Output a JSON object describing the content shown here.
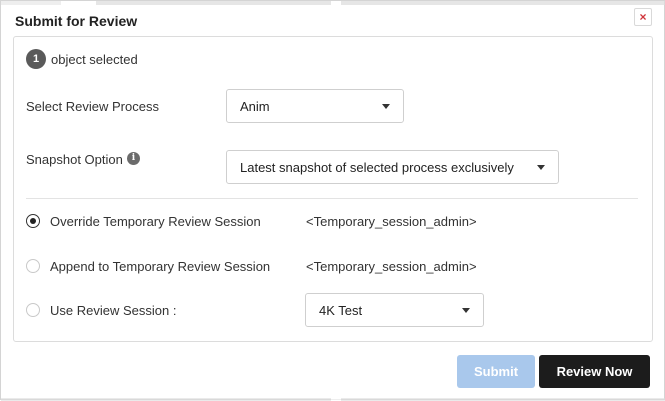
{
  "dialog": {
    "title": "Submit for Review",
    "close_label": "×"
  },
  "selection": {
    "count": "1",
    "text": "object selected"
  },
  "review_process": {
    "label": "Select Review Process",
    "value": "Anim"
  },
  "snapshot": {
    "label": "Snapshot Option",
    "info_glyph": "i",
    "value": "Latest snapshot of selected process exclusively"
  },
  "session_options": [
    {
      "label": "Override Temporary Review Session",
      "value": "<Temporary_session_admin>",
      "checked": true
    },
    {
      "label": "Append to Temporary Review Session",
      "value": "<Temporary_session_admin>",
      "checked": false
    },
    {
      "label": "Use Review Session :",
      "value": "4K Test",
      "checked": false
    }
  ],
  "buttons": {
    "submit": "Submit",
    "review_now": "Review Now"
  },
  "colors": {
    "submit_disabled": "#a9c8ec",
    "review_now": "#1c1c1c",
    "close_x": "#d0343a"
  }
}
